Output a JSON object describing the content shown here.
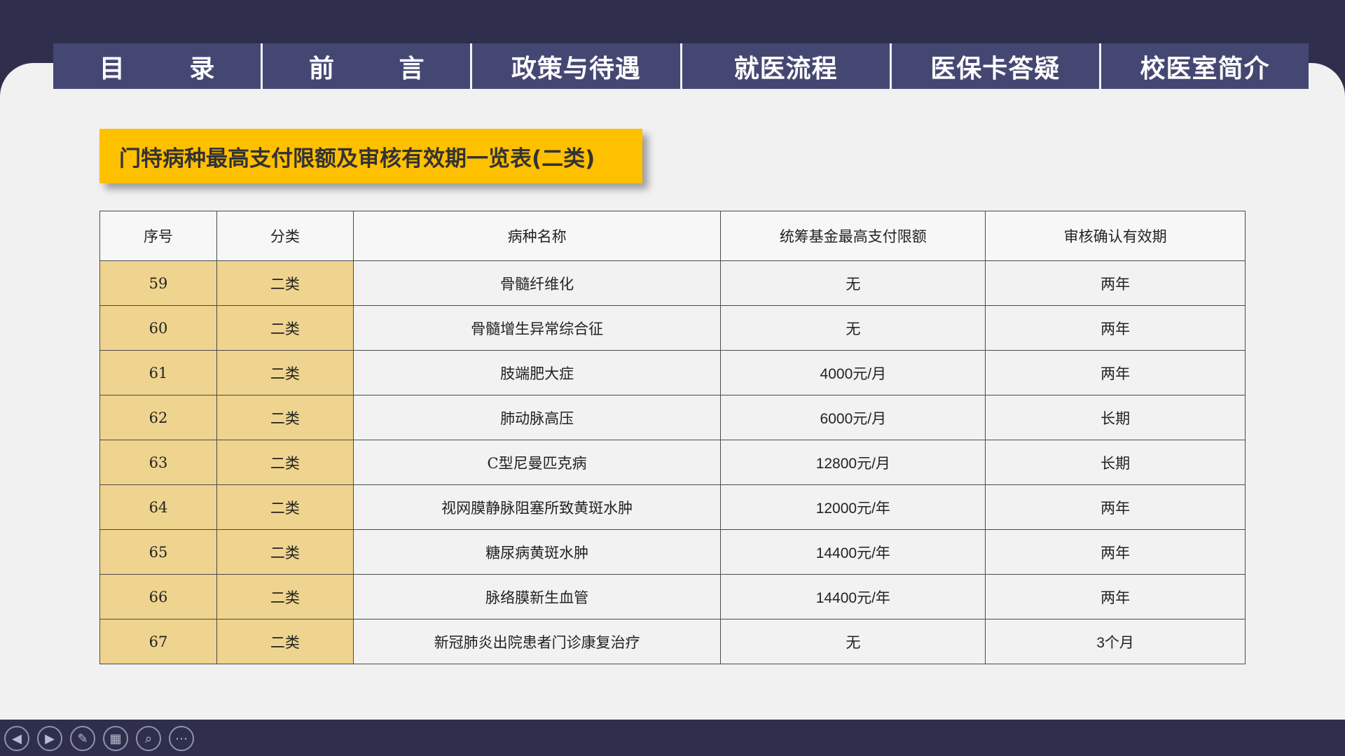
{
  "nav": {
    "tabs": [
      {
        "label": "目 录",
        "spaced": true
      },
      {
        "label": "前 言",
        "spaced": true
      },
      {
        "label": "政策与待遇",
        "spaced": false
      },
      {
        "label": "就医流程",
        "spaced": false
      },
      {
        "label": "医保卡答疑",
        "spaced": false
      },
      {
        "label": "校医室简介",
        "spaced": false
      }
    ]
  },
  "banner": {
    "title": "门特病种最高支付限额及审核有效期一览表(二类)"
  },
  "table": {
    "headers": [
      "序号",
      "分类",
      "病种名称",
      "统筹基金最高支付限额",
      "审核确认有效期"
    ],
    "rows": [
      [
        "59",
        "二类",
        "骨髓纤维化",
        "无",
        "两年"
      ],
      [
        "60",
        "二类",
        "骨髓增生异常综合征",
        "无",
        "两年"
      ],
      [
        "61",
        "二类",
        "肢端肥大症",
        "4000元/月",
        "两年"
      ],
      [
        "62",
        "二类",
        "肺动脉高压",
        "6000元/月",
        "长期"
      ],
      [
        "63",
        "二类",
        "C型尼曼匹克病",
        "12800元/月",
        "长期"
      ],
      [
        "64",
        "二类",
        "视网膜静脉阻塞所致黄斑水肿",
        "12000元/年",
        "两年"
      ],
      [
        "65",
        "二类",
        "糖尿病黄斑水肿",
        "14400元/年",
        "两年"
      ],
      [
        "66",
        "二类",
        "脉络膜新生血管",
        "14400元/年",
        "两年"
      ],
      [
        "67",
        "二类",
        "新冠肺炎出院患者门诊康复治疗",
        "无",
        "3个月"
      ]
    ]
  },
  "toolbar": {
    "buttons": [
      {
        "name": "prev-slide-button",
        "glyph": "◀"
      },
      {
        "name": "next-slide-button",
        "glyph": "▶"
      },
      {
        "name": "pen-tool-button",
        "glyph": "✎"
      },
      {
        "name": "slide-overview-button",
        "glyph": "▦"
      },
      {
        "name": "zoom-button",
        "glyph": "⌕"
      },
      {
        "name": "more-options-button",
        "glyph": "⋯"
      }
    ]
  }
}
